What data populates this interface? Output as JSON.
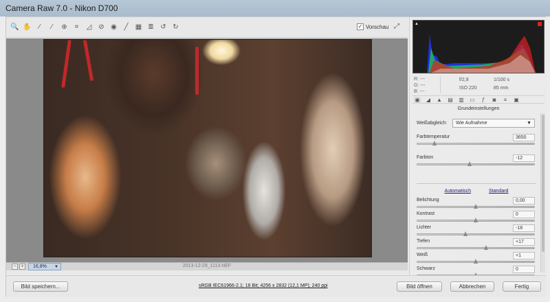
{
  "window": {
    "title": "Camera Raw 7.0 - Nikon D700"
  },
  "toolbar": {
    "tools": [
      "zoom-icon",
      "hand-icon",
      "white-balance-icon",
      "color-sampler-icon",
      "target-adjust-icon",
      "crop-icon",
      "straighten-icon",
      "spot-removal-icon",
      "red-eye-icon",
      "adjustment-brush-icon",
      "graduated-filter-icon",
      "preferences-icon",
      "rotate-left-icon",
      "rotate-right-icon"
    ],
    "preview_label": "Vorschau",
    "preview_checked": "✓"
  },
  "status": {
    "zoom_out": "−",
    "zoom_in": "+",
    "zoom_value": "16,8%",
    "filename": "2013-12-29_1113.NEF"
  },
  "histogram": {
    "shadow_clip": "▲",
    "rgb": {
      "r": "R:  ---",
      "g": "G:  ---",
      "b": "B:  ---"
    },
    "exif": {
      "aperture": "f/2,8",
      "shutter": "1/100 s",
      "iso": "ISO 220",
      "focal": "85 mm"
    }
  },
  "panel_tabs": [
    "basic-icon",
    "tone-curve-icon",
    "detail-icon",
    "hsl-icon",
    "split-toning-icon",
    "lens-icon",
    "fx-icon",
    "camera-calibration-icon",
    "presets-icon",
    "snapshots-icon"
  ],
  "section": {
    "title": "Grundeinstellungen"
  },
  "white_balance": {
    "label": "Weißabgleich:",
    "value": "Wie Aufnahme"
  },
  "params_top": [
    {
      "label": "Farbtemperatur",
      "value": "3650",
      "position": 0.15
    },
    {
      "label": "Farbton",
      "value": "-12",
      "position": 0.45
    }
  ],
  "auto": {
    "automatic": "Automatisch",
    "standard": "Standard"
  },
  "params": [
    {
      "label": "Belichtung",
      "value": "0,00",
      "position": 0.5
    },
    {
      "label": "Kontrast",
      "value": "0",
      "position": 0.5
    },
    {
      "label": "Lichter",
      "value": "-18",
      "position": 0.41
    },
    {
      "label": "Tiefen",
      "value": "+17",
      "position": 0.59
    },
    {
      "label": "Weiß",
      "value": "+1",
      "position": 0.5
    },
    {
      "label": "Schwarz",
      "value": "0",
      "position": 0.5
    }
  ],
  "footer": {
    "save": "Bild speichern...",
    "workflow": "sRGB IEC61966-2.1; 16 Bit; 4256 x 2832 (12,1 MP); 240 ppi",
    "open": "Bild öffnen",
    "cancel": "Abbrechen",
    "done": "Fertig"
  }
}
